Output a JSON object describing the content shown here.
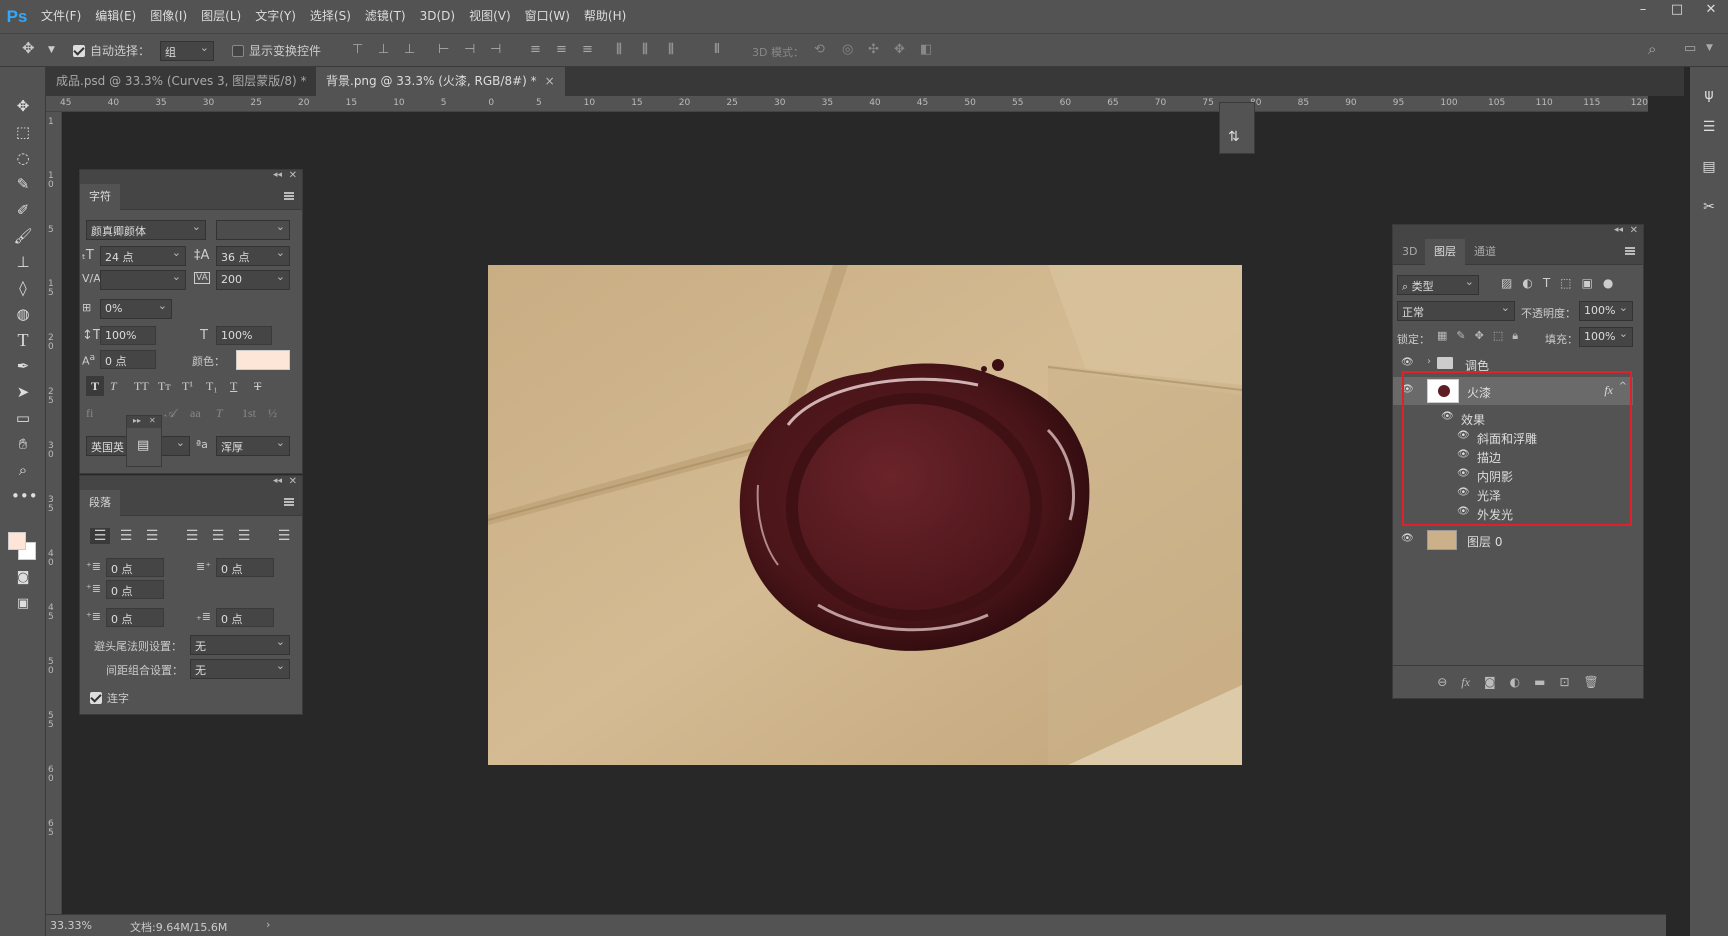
{
  "app": {
    "logo": "Ps"
  },
  "menu": [
    "文件(F)",
    "编辑(E)",
    "图像(I)",
    "图层(L)",
    "文字(Y)",
    "选择(S)",
    "滤镜(T)",
    "3D(D)",
    "视图(V)",
    "窗口(W)",
    "帮助(H)"
  ],
  "options": {
    "auto_select_label": "自动选择：",
    "auto_select_value": "组",
    "show_transform_label": "显示变换控件",
    "mode_3d_label": "3D 模式："
  },
  "tabs": [
    {
      "label": "成品.psd @ 33.3% (Curves 3, 图层蒙版/8) *",
      "close": "×"
    },
    {
      "label": "背景.png @ 33.3% (火漆, RGB/8#) *",
      "close": "×"
    }
  ],
  "ruler_h": [
    "45",
    "40",
    "35",
    "30",
    "25",
    "20",
    "15",
    "10",
    "5",
    "0",
    "5",
    "10",
    "15",
    "20",
    "25",
    "30",
    "35",
    "40",
    "45",
    "50",
    "55",
    "60",
    "65",
    "70",
    "75",
    "80",
    "85",
    "90",
    "95",
    "100",
    "105",
    "110",
    "115",
    "120"
  ],
  "ruler_v": [
    "1",
    "1 0",
    "5",
    "1 5",
    "2 0",
    "2 5",
    "3 0",
    "3 5",
    "4 0",
    "4 5",
    "5 0",
    "5 5",
    "6 0",
    "6 5"
  ],
  "char_panel": {
    "title": "字符",
    "font_family": "颜真卿颜体",
    "size": "24 点",
    "leading": "36 点",
    "tracking": "200",
    "scale_pct": "0%",
    "vscale": "100%",
    "hscale": "100%",
    "baseline": "0 点",
    "color_label": "颜色：",
    "color": "#fde6d7",
    "language": "英国英",
    "aa_method": "浑厚",
    "fi_label": "fi"
  },
  "para_panel": {
    "title": "段落",
    "indent_left": "0 点",
    "indent_right": "0 点",
    "first_indent": "0 点",
    "space_before": "0 点",
    "space_after": "0 点",
    "kinsoku_label": "避头尾法则设置：",
    "kinsoku_value": "无",
    "mojikumi_label": "间距组合设置：",
    "mojikumi_value": "无",
    "hyphen_label": "连字"
  },
  "layers_panel": {
    "tabs": [
      "3D",
      "图层",
      "通道"
    ],
    "filter_label": "类型",
    "blend_mode": "正常",
    "opacity_label": "不透明度：",
    "opacity": "100%",
    "lock_label": "锁定：",
    "fill_label": "填充：",
    "fill": "100%",
    "layers": [
      {
        "name": "调色",
        "type": "group"
      },
      {
        "name": "火漆",
        "type": "layer",
        "fx": "fx"
      },
      {
        "name": "效果",
        "type": "effects"
      },
      {
        "name": "斜面和浮雕",
        "type": "effect"
      },
      {
        "name": "描边",
        "type": "effect"
      },
      {
        "name": "内阴影",
        "type": "effect"
      },
      {
        "name": "光泽",
        "type": "effect"
      },
      {
        "name": "外发光",
        "type": "effect"
      },
      {
        "name": "图层 0",
        "type": "layer"
      }
    ]
  },
  "status": {
    "zoom": "33.33%",
    "doc": "文档:9.64M/15.6M"
  }
}
